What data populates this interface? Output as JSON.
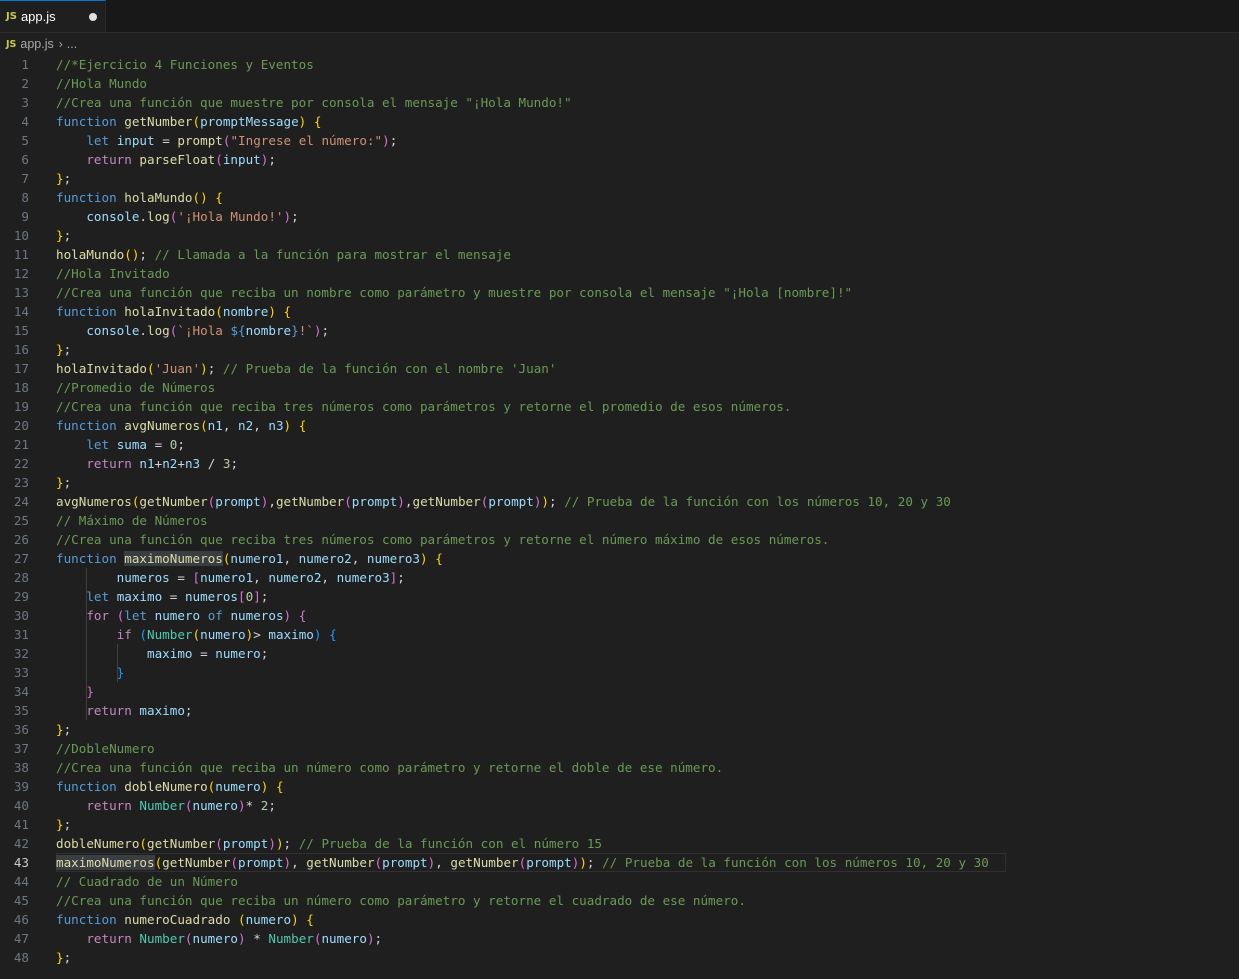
{
  "tab": {
    "icon": "JS",
    "label": "app.js"
  },
  "breadcrumb": {
    "icon": "JS",
    "file": "app.js",
    "rest": "..."
  },
  "editor": {
    "lines": [
      [
        {
          "t": "c",
          "v": "//*Ejercicio 4 Funciones y Eventos"
        }
      ],
      [
        {
          "t": "c",
          "v": "//Hola Mundo"
        }
      ],
      [
        {
          "t": "c",
          "v": "//Crea una función que muestre por consola el mensaje \"¡Hola Mundo!\""
        }
      ],
      [
        {
          "t": "k",
          "v": "function "
        },
        {
          "t": "f",
          "v": "getNumber"
        },
        {
          "t": "b1",
          "v": "("
        },
        {
          "t": "v",
          "v": "promptMessage"
        },
        {
          "t": "b1",
          "v": ")"
        },
        {
          "t": "p",
          "v": " "
        },
        {
          "t": "b1",
          "v": "{"
        }
      ],
      [
        {
          "t": "p",
          "v": "    "
        },
        {
          "t": "k",
          "v": "let "
        },
        {
          "t": "v",
          "v": "input"
        },
        {
          "t": "p",
          "v": " = "
        },
        {
          "t": "f",
          "v": "prompt"
        },
        {
          "t": "b2",
          "v": "("
        },
        {
          "t": "s",
          "v": "\"Ingrese el número:\""
        },
        {
          "t": "b2",
          "v": ")"
        },
        {
          "t": "p",
          "v": ";"
        }
      ],
      [
        {
          "t": "p",
          "v": "    "
        },
        {
          "t": "kc",
          "v": "return "
        },
        {
          "t": "f",
          "v": "parseFloat"
        },
        {
          "t": "b2",
          "v": "("
        },
        {
          "t": "v",
          "v": "input"
        },
        {
          "t": "b2",
          "v": ")"
        },
        {
          "t": "p",
          "v": ";"
        }
      ],
      [
        {
          "t": "b1",
          "v": "}"
        },
        {
          "t": "p",
          "v": ";"
        }
      ],
      [
        {
          "t": "k",
          "v": "function "
        },
        {
          "t": "f",
          "v": "holaMundo"
        },
        {
          "t": "b1",
          "v": "()"
        },
        {
          "t": "p",
          "v": " "
        },
        {
          "t": "b1",
          "v": "{"
        }
      ],
      [
        {
          "t": "p",
          "v": "    "
        },
        {
          "t": "v",
          "v": "console"
        },
        {
          "t": "p",
          "v": "."
        },
        {
          "t": "f",
          "v": "log"
        },
        {
          "t": "b2",
          "v": "("
        },
        {
          "t": "s",
          "v": "'¡Hola Mundo!'"
        },
        {
          "t": "b2",
          "v": ")"
        },
        {
          "t": "p",
          "v": ";"
        }
      ],
      [
        {
          "t": "b1",
          "v": "}"
        },
        {
          "t": "p",
          "v": ";"
        }
      ],
      [
        {
          "t": "f",
          "v": "holaMundo"
        },
        {
          "t": "b1",
          "v": "()"
        },
        {
          "t": "p",
          "v": "; "
        },
        {
          "t": "c",
          "v": "// Llamada a la función para mostrar el mensaje"
        }
      ],
      [
        {
          "t": "c",
          "v": "//Hola Invitado"
        }
      ],
      [
        {
          "t": "c",
          "v": "//Crea una función que reciba un nombre como parámetro y muestre por consola el mensaje \"¡Hola [nombre]!\""
        }
      ],
      [
        {
          "t": "k",
          "v": "function "
        },
        {
          "t": "f",
          "v": "holaInvitado"
        },
        {
          "t": "b1",
          "v": "("
        },
        {
          "t": "v",
          "v": "nombre"
        },
        {
          "t": "b1",
          "v": ")"
        },
        {
          "t": "p",
          "v": " "
        },
        {
          "t": "b1",
          "v": "{"
        }
      ],
      [
        {
          "t": "p",
          "v": "    "
        },
        {
          "t": "v",
          "v": "console"
        },
        {
          "t": "p",
          "v": "."
        },
        {
          "t": "f",
          "v": "log"
        },
        {
          "t": "b2",
          "v": "("
        },
        {
          "t": "s",
          "v": "`¡Hola "
        },
        {
          "t": "k",
          "v": "${"
        },
        {
          "t": "v",
          "v": "nombre"
        },
        {
          "t": "k",
          "v": "}"
        },
        {
          "t": "s",
          "v": "!`"
        },
        {
          "t": "b2",
          "v": ")"
        },
        {
          "t": "p",
          "v": ";"
        }
      ],
      [
        {
          "t": "b1",
          "v": "}"
        },
        {
          "t": "p",
          "v": ";"
        }
      ],
      [
        {
          "t": "f",
          "v": "holaInvitado"
        },
        {
          "t": "b1",
          "v": "("
        },
        {
          "t": "s",
          "v": "'Juan'"
        },
        {
          "t": "b1",
          "v": ")"
        },
        {
          "t": "p",
          "v": "; "
        },
        {
          "t": "c",
          "v": "// Prueba de la función con el nombre 'Juan'"
        }
      ],
      [
        {
          "t": "c",
          "v": "//Promedio de Números"
        }
      ],
      [
        {
          "t": "c",
          "v": "//Crea una función que reciba tres números como parámetros y retorne el promedio de esos números."
        }
      ],
      [
        {
          "t": "k",
          "v": "function "
        },
        {
          "t": "f",
          "v": "avgNumeros"
        },
        {
          "t": "b1",
          "v": "("
        },
        {
          "t": "v",
          "v": "n1"
        },
        {
          "t": "p",
          "v": ", "
        },
        {
          "t": "v",
          "v": "n2"
        },
        {
          "t": "p",
          "v": ", "
        },
        {
          "t": "v",
          "v": "n3"
        },
        {
          "t": "b1",
          "v": ")"
        },
        {
          "t": "p",
          "v": " "
        },
        {
          "t": "b1",
          "v": "{"
        }
      ],
      [
        {
          "t": "p",
          "v": "    "
        },
        {
          "t": "k",
          "v": "let "
        },
        {
          "t": "v",
          "v": "suma"
        },
        {
          "t": "p",
          "v": " = "
        },
        {
          "t": "n",
          "v": "0"
        },
        {
          "t": "p",
          "v": ";"
        }
      ],
      [
        {
          "t": "p",
          "v": "    "
        },
        {
          "t": "kc",
          "v": "return "
        },
        {
          "t": "v",
          "v": "n1"
        },
        {
          "t": "p",
          "v": "+"
        },
        {
          "t": "v",
          "v": "n2"
        },
        {
          "t": "p",
          "v": "+"
        },
        {
          "t": "v",
          "v": "n3"
        },
        {
          "t": "p",
          "v": " / "
        },
        {
          "t": "n",
          "v": "3"
        },
        {
          "t": "p",
          "v": ";"
        }
      ],
      [
        {
          "t": "b1",
          "v": "}"
        },
        {
          "t": "p",
          "v": ";"
        }
      ],
      [
        {
          "t": "f",
          "v": "avgNumeros"
        },
        {
          "t": "b1",
          "v": "("
        },
        {
          "t": "f",
          "v": "getNumber"
        },
        {
          "t": "b2",
          "v": "("
        },
        {
          "t": "v",
          "v": "prompt"
        },
        {
          "t": "b2",
          "v": ")"
        },
        {
          "t": "p",
          "v": ","
        },
        {
          "t": "f",
          "v": "getNumber"
        },
        {
          "t": "b2",
          "v": "("
        },
        {
          "t": "v",
          "v": "prompt"
        },
        {
          "t": "b2",
          "v": ")"
        },
        {
          "t": "p",
          "v": ","
        },
        {
          "t": "f",
          "v": "getNumber"
        },
        {
          "t": "b2",
          "v": "("
        },
        {
          "t": "v",
          "v": "prompt"
        },
        {
          "t": "b2",
          "v": ")"
        },
        {
          "t": "b1",
          "v": ")"
        },
        {
          "t": "p",
          "v": "; "
        },
        {
          "t": "c",
          "v": "// Prueba de la función con los números 10, 20 y 30"
        }
      ],
      [
        {
          "t": "c",
          "v": "// Máximo de Números"
        }
      ],
      [
        {
          "t": "c",
          "v": "//Crea una función que reciba tres números como parámetros y retorne el número máximo de esos números."
        }
      ],
      [
        {
          "t": "k",
          "v": "function "
        },
        {
          "t": "fh",
          "v": "maximoNumeros"
        },
        {
          "t": "b1",
          "v": "("
        },
        {
          "t": "v",
          "v": "numero1"
        },
        {
          "t": "p",
          "v": ", "
        },
        {
          "t": "v",
          "v": "numero2"
        },
        {
          "t": "p",
          "v": ", "
        },
        {
          "t": "v",
          "v": "numero3"
        },
        {
          "t": "b1",
          "v": ")"
        },
        {
          "t": "p",
          "v": " "
        },
        {
          "t": "b1",
          "v": "{"
        }
      ],
      [
        {
          "t": "p",
          "v": "        "
        },
        {
          "t": "v",
          "v": "numeros"
        },
        {
          "t": "p",
          "v": " = "
        },
        {
          "t": "b2",
          "v": "["
        },
        {
          "t": "v",
          "v": "numero1"
        },
        {
          "t": "p",
          "v": ", "
        },
        {
          "t": "v",
          "v": "numero2"
        },
        {
          "t": "p",
          "v": ", "
        },
        {
          "t": "v",
          "v": "numero3"
        },
        {
          "t": "b2",
          "v": "]"
        },
        {
          "t": "p",
          "v": ";"
        }
      ],
      [
        {
          "t": "p",
          "v": "    "
        },
        {
          "t": "k",
          "v": "let "
        },
        {
          "t": "v",
          "v": "maximo"
        },
        {
          "t": "p",
          "v": " = "
        },
        {
          "t": "v",
          "v": "numeros"
        },
        {
          "t": "b2",
          "v": "["
        },
        {
          "t": "n",
          "v": "0"
        },
        {
          "t": "b2",
          "v": "]"
        },
        {
          "t": "p",
          "v": ";"
        }
      ],
      [
        {
          "t": "p",
          "v": "    "
        },
        {
          "t": "kc",
          "v": "for "
        },
        {
          "t": "b2",
          "v": "("
        },
        {
          "t": "k",
          "v": "let "
        },
        {
          "t": "v",
          "v": "numero"
        },
        {
          "t": "p",
          "v": " "
        },
        {
          "t": "k",
          "v": "of "
        },
        {
          "t": "v",
          "v": "numeros"
        },
        {
          "t": "b2",
          "v": ")"
        },
        {
          "t": "p",
          "v": " "
        },
        {
          "t": "b2",
          "v": "{"
        }
      ],
      [
        {
          "t": "p",
          "v": "        "
        },
        {
          "t": "kc",
          "v": "if "
        },
        {
          "t": "b3",
          "v": "("
        },
        {
          "t": "ty",
          "v": "Number"
        },
        {
          "t": "b1",
          "v": "("
        },
        {
          "t": "v",
          "v": "numero"
        },
        {
          "t": "b1",
          "v": ")"
        },
        {
          "t": "p",
          "v": "> "
        },
        {
          "t": "v",
          "v": "maximo"
        },
        {
          "t": "b3",
          "v": ")"
        },
        {
          "t": "p",
          "v": " "
        },
        {
          "t": "b3",
          "v": "{"
        }
      ],
      [
        {
          "t": "p",
          "v": "            "
        },
        {
          "t": "v",
          "v": "maximo"
        },
        {
          "t": "p",
          "v": " = "
        },
        {
          "t": "v",
          "v": "numero"
        },
        {
          "t": "p",
          "v": ";"
        }
      ],
      [
        {
          "t": "p",
          "v": "        "
        },
        {
          "t": "b3",
          "v": "}"
        }
      ],
      [
        {
          "t": "p",
          "v": "    "
        },
        {
          "t": "b2",
          "v": "}"
        }
      ],
      [
        {
          "t": "p",
          "v": "    "
        },
        {
          "t": "kc",
          "v": "return "
        },
        {
          "t": "v",
          "v": "maximo"
        },
        {
          "t": "p",
          "v": ";"
        }
      ],
      [
        {
          "t": "b1",
          "v": "}"
        },
        {
          "t": "p",
          "v": ";"
        }
      ],
      [
        {
          "t": "c",
          "v": "//DobleNumero"
        }
      ],
      [
        {
          "t": "c",
          "v": "//Crea una función que reciba un número como parámetro y retorne el doble de ese número."
        }
      ],
      [
        {
          "t": "k",
          "v": "function "
        },
        {
          "t": "f",
          "v": "dobleNumero"
        },
        {
          "t": "b1",
          "v": "("
        },
        {
          "t": "v",
          "v": "numero"
        },
        {
          "t": "b1",
          "v": ")"
        },
        {
          "t": "p",
          "v": " "
        },
        {
          "t": "b1",
          "v": "{"
        }
      ],
      [
        {
          "t": "p",
          "v": "    "
        },
        {
          "t": "kc",
          "v": "return "
        },
        {
          "t": "ty",
          "v": "Number"
        },
        {
          "t": "b2",
          "v": "("
        },
        {
          "t": "v",
          "v": "numero"
        },
        {
          "t": "b2",
          "v": ")"
        },
        {
          "t": "p",
          "v": "* "
        },
        {
          "t": "n",
          "v": "2"
        },
        {
          "t": "p",
          "v": ";"
        }
      ],
      [
        {
          "t": "b1",
          "v": "}"
        },
        {
          "t": "p",
          "v": ";"
        }
      ],
      [
        {
          "t": "f",
          "v": "dobleNumero"
        },
        {
          "t": "b1",
          "v": "("
        },
        {
          "t": "f",
          "v": "getNumber"
        },
        {
          "t": "b2",
          "v": "("
        },
        {
          "t": "v",
          "v": "prompt"
        },
        {
          "t": "b2",
          "v": ")"
        },
        {
          "t": "b1",
          "v": ")"
        },
        {
          "t": "p",
          "v": "; "
        },
        {
          "t": "c",
          "v": "// Prueba de la función con el número 15"
        }
      ],
      [
        {
          "t": "fh",
          "v": "maximoNumeros"
        },
        {
          "t": "b1",
          "v": "("
        },
        {
          "t": "f",
          "v": "getNumber"
        },
        {
          "t": "b2",
          "v": "("
        },
        {
          "t": "v",
          "v": "prompt"
        },
        {
          "t": "b2",
          "v": ")"
        },
        {
          "t": "p",
          "v": ", "
        },
        {
          "t": "f",
          "v": "getNumber"
        },
        {
          "t": "b2",
          "v": "("
        },
        {
          "t": "v",
          "v": "prompt"
        },
        {
          "t": "b2",
          "v": ")"
        },
        {
          "t": "p",
          "v": ", "
        },
        {
          "t": "f",
          "v": "getNumber"
        },
        {
          "t": "b2",
          "v": "("
        },
        {
          "t": "v",
          "v": "prompt"
        },
        {
          "t": "b2",
          "v": ")"
        },
        {
          "t": "b1",
          "v": ")"
        },
        {
          "t": "p",
          "v": "; "
        },
        {
          "t": "c",
          "v": "// Prueba de la función con los números 10, 20 y 30"
        }
      ],
      [
        {
          "t": "c",
          "v": "// Cuadrado de un Número"
        }
      ],
      [
        {
          "t": "c",
          "v": "//Crea una función que reciba un número como parámetro y retorne el cuadrado de ese número."
        }
      ],
      [
        {
          "t": "k",
          "v": "function "
        },
        {
          "t": "f",
          "v": "numeroCuadrado"
        },
        {
          "t": "p",
          "v": " "
        },
        {
          "t": "b1",
          "v": "("
        },
        {
          "t": "v",
          "v": "numero"
        },
        {
          "t": "b1",
          "v": ")"
        },
        {
          "t": "p",
          "v": " "
        },
        {
          "t": "b1",
          "v": "{"
        }
      ],
      [
        {
          "t": "p",
          "v": "    "
        },
        {
          "t": "kc",
          "v": "return "
        },
        {
          "t": "ty",
          "v": "Number"
        },
        {
          "t": "b2",
          "v": "("
        },
        {
          "t": "v",
          "v": "numero"
        },
        {
          "t": "b2",
          "v": ")"
        },
        {
          "t": "p",
          "v": " * "
        },
        {
          "t": "ty",
          "v": "Number"
        },
        {
          "t": "b2",
          "v": "("
        },
        {
          "t": "v",
          "v": "numero"
        },
        {
          "t": "b2",
          "v": ")"
        },
        {
          "t": "p",
          "v": ";"
        }
      ],
      [
        {
          "t": "b1",
          "v": "}"
        },
        {
          "t": "p",
          "v": ";"
        }
      ]
    ]
  }
}
